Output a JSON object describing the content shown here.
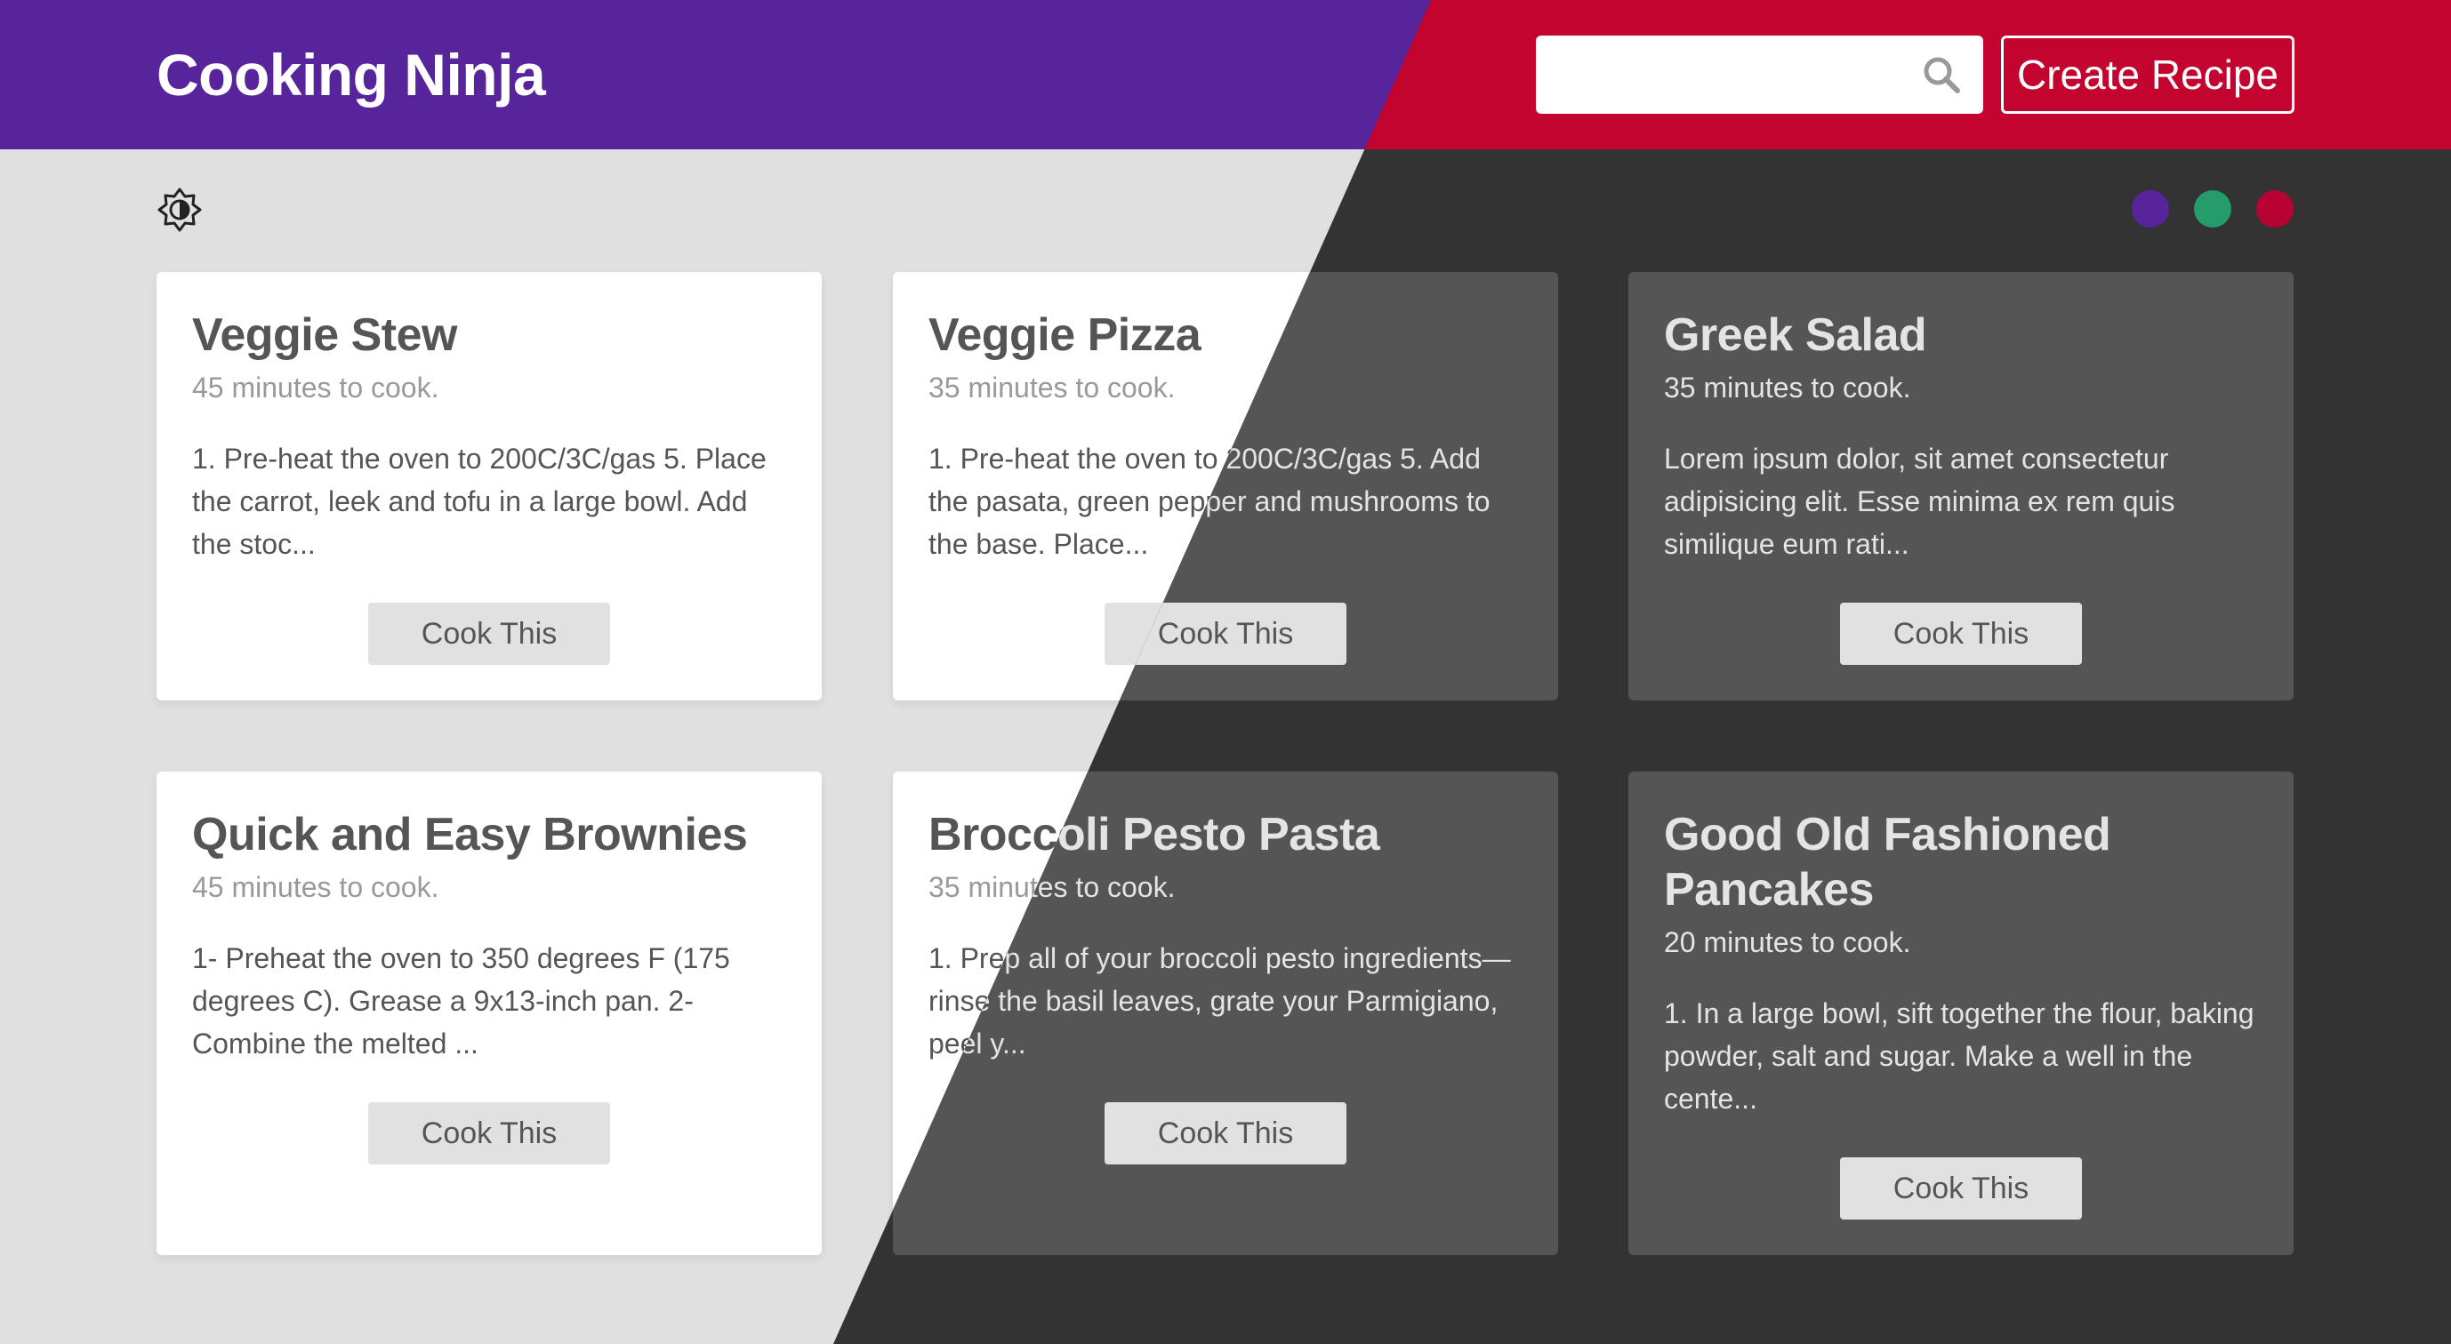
{
  "app": {
    "brand": "Cooking Ninja"
  },
  "search": {
    "placeholder": "",
    "value": ""
  },
  "actions": {
    "create_label": "Create Recipe"
  },
  "theme": {
    "light_navbar": "#58249c",
    "dark_navbar": "#c2042f",
    "dots": [
      "#58249c",
      "#249c6b",
      "#b70233"
    ]
  },
  "recipes": [
    {
      "title": "Veggie Stew",
      "time": "45 minutes to cook.",
      "method": "1. Pre-heat the oven to 200C/3C/gas 5. Place the carrot, leek and tofu in a large bowl. Add the stoc...",
      "button": "Cook This"
    },
    {
      "title": "Veggie Pizza",
      "time": "35 minutes to cook.",
      "method": "1. Pre-heat the oven to 200C/3C/gas 5. Add the pasata, green pepper and mushrooms to the base. Place...",
      "button": "Cook This"
    },
    {
      "title": "Greek Salad",
      "time": "35 minutes to cook.",
      "method": "Lorem ipsum dolor, sit amet consectetur adipisicing elit. Esse minima ex rem quis similique eum rati...",
      "button": "Cook This"
    },
    {
      "title": "Quick and Easy Brownies",
      "time": "45 minutes to cook.",
      "method": "1- Preheat the oven to 350 degrees F (175 degrees C). Grease a 9x13-inch pan. 2- Combine the melted ...",
      "button": "Cook This"
    },
    {
      "title": "Broccoli Pesto Pasta",
      "time": "35 minutes to cook.",
      "method": "1. Prep all of your broccoli pesto ingredients—rinse the basil leaves, grate your Parmigiano, peel y...",
      "button": "Cook This"
    },
    {
      "title": "Good Old Fashioned Pancakes",
      "time": "20 minutes to cook.",
      "method": "1. In a large bowl, sift together the flour, baking powder, salt and sugar. Make a well in the cente...",
      "button": "Cook This"
    }
  ]
}
